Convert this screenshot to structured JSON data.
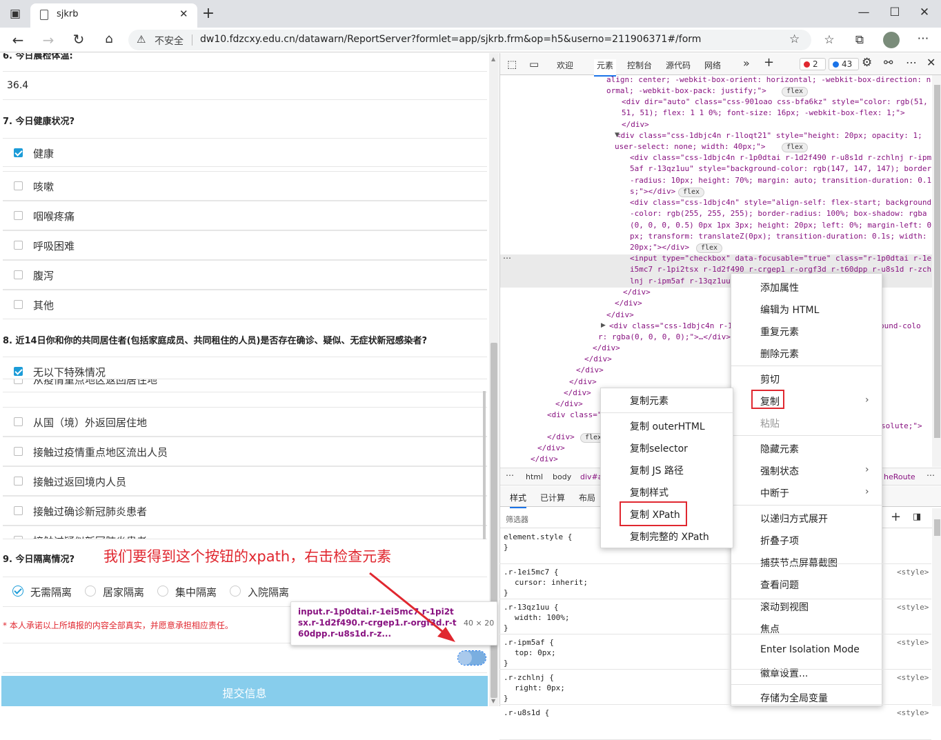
{
  "browser": {
    "tab_title": "sjkrb",
    "security_label": "不安全",
    "url": "dw10.fdzcxy.edu.cn/datawarn/ReportServer?formlet=app/sjkrb.frm&op=h5&userno=211906371#/form"
  },
  "form": {
    "q6_partial": "6. 今日晨检体温:",
    "temperature_value": "36.4",
    "q7_title": "7. 今日健康状况?",
    "q7_options": [
      {
        "label": "健康",
        "checked": true
      },
      {
        "label": "咳嗽",
        "checked": false
      },
      {
        "label": "咽喉疼痛",
        "checked": false
      },
      {
        "label": "呼吸困难",
        "checked": false
      },
      {
        "label": "腹泻",
        "checked": false
      },
      {
        "label": "其他",
        "checked": false
      }
    ],
    "q8_title": "8. 近14日你和你的共同居住者(包括家庭成员、共同租住的人员)是否存在确诊、疑似、无症状新冠感染者?",
    "q8_options": [
      {
        "label": "无以下特殊情况",
        "checked": true
      },
      {
        "label": "从疫情重点地区返回居住地",
        "checked": false
      },
      {
        "label": "从国（境）外返回居住地",
        "checked": false
      },
      {
        "label": "接触过疫情重点地区流出人员",
        "checked": false
      },
      {
        "label": "接触过返回境内人员",
        "checked": false
      },
      {
        "label": "接触过确诊新冠肺炎患者",
        "checked": false
      },
      {
        "label": "接触过疑似新冠肺炎患者",
        "checked": false
      }
    ],
    "q9_title": "9. 今日隔离情况?",
    "q9_options": [
      {
        "label": "无需隔离",
        "checked": true
      },
      {
        "label": "居家隔离",
        "checked": false
      },
      {
        "label": "集中隔离",
        "checked": false
      },
      {
        "label": "入院隔离",
        "checked": false
      }
    ],
    "pledge": "* 本人承诺以上所填报的内容全部真实，并愿意承担相应责任。",
    "submit_label": "提交信息",
    "annotation": "我们要得到这个按钮的xpath，右击检查元素"
  },
  "tooltip": {
    "selector": "input.r-1p0dtai.r-1ei5mc7.r-1pi2tsx.r-1d2f490.r-crgep1.r-orgf3d.r-t60dpp.r-u8s1d.r-z...",
    "size": "40 × 20"
  },
  "devtools": {
    "tabs": [
      "欢迎",
      "元素",
      "控制台",
      "源代码",
      "网络"
    ],
    "active_tab": "元素",
    "error_count": "2",
    "message_count": "43",
    "code_lines": [
      "align: center; -webkit-box-orient: horizontal; -webkit-box-direction: n",
      "ormal; -webkit-box-pack: justify;\">",
      "<div dir=\"auto\" class=\"css-901oao css-bfa6kz\" style=\"color: rgb(51,",
      "51, 51); flex: 1 1 0%; font-size: 16px; -webkit-box-flex: 1;\">",
      "</div>",
      "<div class=\"css-1dbjc4n r-1loqt21\" style=\"height: 20px; opacity: 1;",
      "user-select: none; width: 40px;\">",
      "<div class=\"css-1dbjc4n r-1p0dtai r-1d2f490 r-u8s1d r-zchlnj r-ipm",
      "5af r-13qz1uu\" style=\"background-color: rgb(147, 147, 147); border",
      "-radius: 10px; height: 70%; margin: auto; transition-duration: 0.1",
      "s;\"></div>",
      "<div class=\"css-1dbjc4n\" style=\"align-self: flex-start; background",
      "-color: rgb(255, 255, 255); border-radius: 100%; box-shadow: rgba",
      "(0, 0, 0, 0.5) 0px 1px 3px; height: 20px; left: 0%; margin-left: 0",
      "px; transform: translateZ(0px); transition-duration: 0.1s; width:",
      "20px;\"></div>",
      "<input type=\"checkbox\" data-focusable=\"true\" class=\"r-1p0dtai r-1e",
      "i5mc7 r-1pi2tsx r-1d2f490 r-crgep1 r-orgf3d r-t60dpp r-u8s1d r-zch",
      "lnj r-ipm5af r-13qz1uu",
      "</div>",
      "</div>",
      "</div>",
      "<div class=\"css-1dbjc4n r-1",
      "ound-colo",
      "r: rgba(0, 0, 0, 0);\">…</div>",
      "</div>",
      "</div>",
      "</div>",
      "</div>",
      "</div>",
      "</div>",
      "<div class=\"",
      "solute;\">",
      "</div>",
      "</div>",
      "</div>"
    ],
    "flex_badge": "flex",
    "breadcrumbs": [
      "html",
      "body",
      "div#a",
      "heRoute"
    ],
    "style_tabs": [
      "样式",
      "已计算",
      "布局"
    ],
    "filter_placeholder": "筛选器",
    "style_rules": [
      {
        "selector": "element.style {",
        "prop": ""
      },
      {
        "selector": ".r-1ei5mc7 {",
        "prop": "cursor: inherit;"
      },
      {
        "selector": ".r-13qz1uu {",
        "prop": "width: 100%;"
      },
      {
        "selector": ".r-ipm5af {",
        "prop": "top: 0px;"
      },
      {
        "selector": ".r-zchlnj {",
        "prop": "right: 0px;"
      },
      {
        "selector": ".r-u8s1d {",
        "prop": ""
      }
    ],
    "style_source": "<style>",
    "close_brace": "}"
  },
  "context_menu": {
    "items": [
      "添加属性",
      "编辑为 HTML",
      "重复元素",
      "删除元素",
      "剪切",
      "复制",
      "粘贴",
      "隐藏元素",
      "强制状态",
      "中断于",
      "以递归方式展开",
      "折叠子项",
      "捕获节点屏幕截图",
      "查看问题",
      "滚动到视图",
      "焦点",
      "Enter Isolation Mode",
      "徽章设置...",
      "存储为全局变量"
    ]
  },
  "copy_submenu": {
    "items": [
      "复制元素",
      "复制 outerHTML",
      "复制selector",
      "复制 JS 路径",
      "复制样式",
      "复制 XPath",
      "复制完整的 XPath"
    ]
  },
  "colors": {
    "accent": "#1c9cd8",
    "annotation_red": "#e0272f",
    "submit_bg": "#87cdec"
  }
}
